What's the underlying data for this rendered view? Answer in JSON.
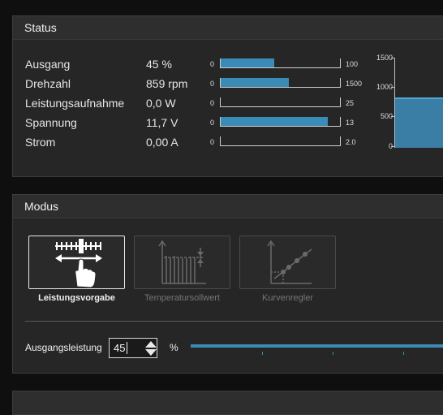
{
  "status": {
    "title": "Status",
    "rows": [
      {
        "label": "Ausgang",
        "value": "45 %",
        "min": "0",
        "max": "100",
        "fraction": 0.45
      },
      {
        "label": "Drehzahl",
        "value": "859 rpm",
        "min": "0",
        "max": "1500",
        "fraction": 0.573
      },
      {
        "label": "Leistungsaufnahme",
        "value": "0,0 W",
        "min": "0",
        "max": "25",
        "fraction": 0
      },
      {
        "label": "Spannung",
        "value": "11,7 V",
        "min": "0",
        "max": "13",
        "fraction": 0.9
      },
      {
        "label": "Strom",
        "value": "0,00 A",
        "min": "0",
        "max": "2.0",
        "fraction": 0
      }
    ],
    "gauge": {
      "ticks": [
        "1500",
        "1000",
        "500",
        "0"
      ],
      "value": 859,
      "max": 1500
    }
  },
  "mode": {
    "title": "Modus",
    "buttons": [
      {
        "label": "Leistungsvorgabe",
        "active": true
      },
      {
        "label": "Temperatursollwert",
        "active": false
      },
      {
        "label": "Kurvenregler",
        "active": false
      }
    ],
    "output_label": "Ausgangsleistung",
    "output_value": "45",
    "unit": "%"
  },
  "colors": {
    "accent": "#3a8bb5",
    "panel": "#262626",
    "background": "#0f0f0f"
  }
}
